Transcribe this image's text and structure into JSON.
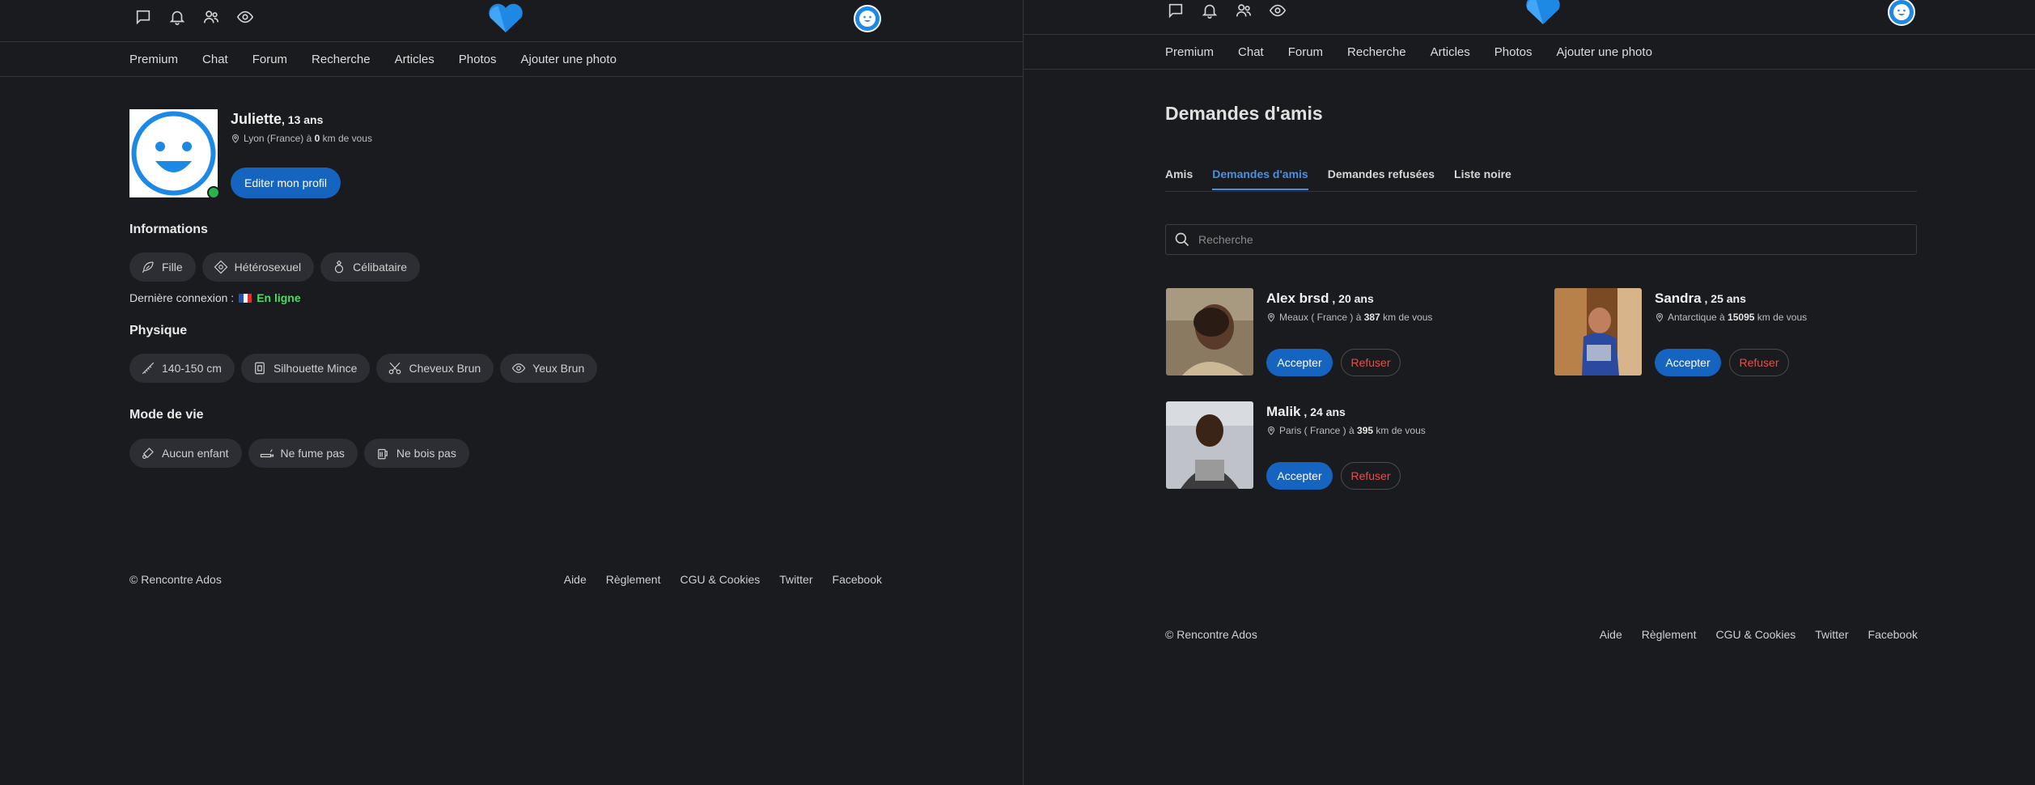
{
  "app": {
    "accent": "#1565c0",
    "heart_color": "#1e88e5",
    "online_color": "#2bb24c"
  },
  "icons": [
    "chat-icon",
    "bell-icon",
    "users-icon",
    "eye-icon"
  ],
  "nav": [
    "Premium",
    "Chat",
    "Forum",
    "Recherche",
    "Articles",
    "Photos",
    "Ajouter une photo"
  ],
  "profile": {
    "name": "Juliette",
    "age": ", 13 ans",
    "location_prefix": "Lyon (France) à ",
    "distance": "0",
    "location_suffix": " km de vous",
    "edit_label": "Editer mon profil",
    "informations_title": "Informations",
    "informations": [
      "Fille",
      "Hétérosexuel",
      "Célibataire"
    ],
    "last_connection_label": "Dernière connexion :",
    "last_connection_value": "En ligne",
    "physique_title": "Physique",
    "physique": [
      "140-150 cm",
      "Silhouette Mince",
      "Cheveux Brun",
      "Yeux Brun"
    ],
    "lifestyle_title": "Mode de vie",
    "lifestyle": [
      "Aucun enfant",
      "Ne fume pas",
      "Ne bois pas"
    ]
  },
  "footer": {
    "copyright": "© Rencontre Ados",
    "links": [
      "Aide",
      "Règlement",
      "CGU & Cookies",
      "Twitter",
      "Facebook"
    ]
  },
  "friends": {
    "title": "Demandes d'amis",
    "tabs": [
      "Amis",
      "Demandes d'amis",
      "Demandes refusées",
      "Liste noire"
    ],
    "active_tab": 1,
    "search_placeholder": "Recherche",
    "accept_label": "Accepter",
    "refuse_label": "Refuser",
    "requests": [
      {
        "name": "Alex brsd",
        "age": " , 20 ans",
        "loc_prefix": "Meaux ( France ) à ",
        "distance": "387",
        "loc_suffix": " km de vous"
      },
      {
        "name": "Sandra",
        "age": " , 25 ans",
        "loc_prefix": "Antarctique à ",
        "distance": "15095",
        "loc_suffix": " km de vous"
      },
      {
        "name": "Malik",
        "age": " , 24 ans",
        "loc_prefix": "Paris ( France ) à ",
        "distance": "395",
        "loc_suffix": " km de vous"
      }
    ]
  }
}
